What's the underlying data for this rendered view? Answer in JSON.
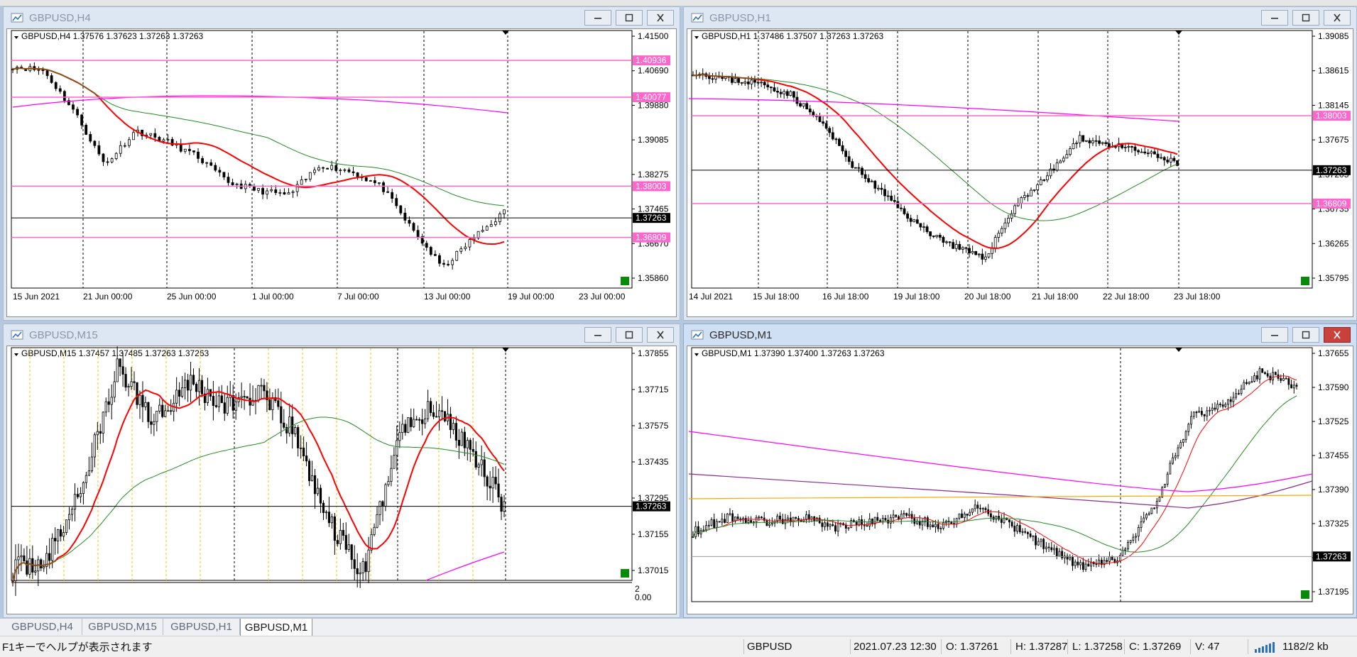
{
  "windows": [
    {
      "title": "GBPUSD,H4",
      "active": false,
      "header": "GBPUSD,H4  1.37576 1.37623 1.37263 1.37263",
      "yaxis": [
        "1.41500",
        "1.40690",
        "1.39880",
        "1.39085",
        "1.38275",
        "1.37465",
        "1.36670",
        "1.35860"
      ],
      "xaxis": [
        "15 Jun 2021",
        "21 Jun 00:00",
        "25 Jun 00:00",
        "1 Jul 00:00",
        "7 Jul 00:00",
        "13 Jul 00:00",
        "19 Jul 00:00",
        "23 Jul 00:00"
      ],
      "hlines": [
        {
          "price": "1.40936",
          "color": "#ff66cc"
        },
        {
          "price": "1.40077",
          "color": "#ff66cc"
        },
        {
          "price": "1.38003",
          "color": "#ff66cc"
        },
        {
          "price": "1.36809",
          "color": "#ff66cc"
        }
      ],
      "current_price": "1.37263"
    },
    {
      "title": "GBPUSD,H1",
      "active": false,
      "header": "GBPUSD,H1  1.37486 1.37507 1.37263 1.37263",
      "yaxis": [
        "1.39085",
        "1.38615",
        "1.38145",
        "1.37675",
        "1.37205",
        "1.36735",
        "1.36265",
        "1.35795"
      ],
      "xaxis": [
        "14 Jul 2021",
        "15 Jul 18:00",
        "16 Jul 18:00",
        "19 Jul 18:00",
        "20 Jul 18:00",
        "21 Jul 18:00",
        "22 Jul 18:00",
        "23 Jul 18:00"
      ],
      "hlines": [
        {
          "price": "1.38003",
          "color": "#ff66cc"
        },
        {
          "price": "1.36809",
          "color": "#ff66cc"
        }
      ],
      "current_price": "1.37263"
    },
    {
      "title": "GBPUSD,M15",
      "active": false,
      "header": "GBPUSD,M15  1.37457 1.37485 1.37263 1.37263",
      "yaxis": [
        "1.37855",
        "1.37715",
        "1.37575",
        "1.37435",
        "1.37295",
        "1.37155",
        "1.37015"
      ],
      "sub_yaxis": [
        "2",
        "0.00"
      ],
      "xaxis": [],
      "hlines": [],
      "current_price": "1.37263"
    },
    {
      "title": "GBPUSD,M1",
      "active": true,
      "header": "GBPUSD,M1  1.37390 1.37400 1.37263 1.37263",
      "yaxis": [
        "1.37655",
        "1.37590",
        "1.37525",
        "1.37455",
        "1.37390",
        "1.37325",
        "1.37260",
        "1.37195"
      ],
      "xaxis": [],
      "hlines": [],
      "current_price": "1.37263"
    }
  ],
  "tabs": [
    {
      "label": "GBPUSD,H4",
      "active": false
    },
    {
      "label": "GBPUSD,M15",
      "active": false
    },
    {
      "label": "GBPUSD,H1",
      "active": false
    },
    {
      "label": "GBPUSD,M1",
      "active": true
    }
  ],
  "status": {
    "help": "F1キーでヘルプが表示されます",
    "symbol": "GBPUSD",
    "datetime": "2021.07.23 12:30",
    "open": "O: 1.37261",
    "high": "H: 1.37287",
    "low": "L: 1.37258",
    "close": "C: 1.37269",
    "volume": "V: 47",
    "traffic": "1182/2 kb"
  },
  "colors": {
    "bull": "#ffffff",
    "bear": "#000000",
    "ma_fast": "#ff0000",
    "ma_mid": "#228b22",
    "ma_slow": "#ff00ff",
    "ma_m1_purple": "#8b2d8b",
    "ma_m1_orange": "#ffa500",
    "hline": "#ff66cc",
    "price_label_bg": "#000000",
    "separator_gold": "#ffc000"
  },
  "icons": {
    "chart": "chart-window-icon",
    "minimize": "minimize-icon",
    "maximize": "maximize-icon",
    "close": "close-icon",
    "connection": "signal-bars-icon"
  }
}
